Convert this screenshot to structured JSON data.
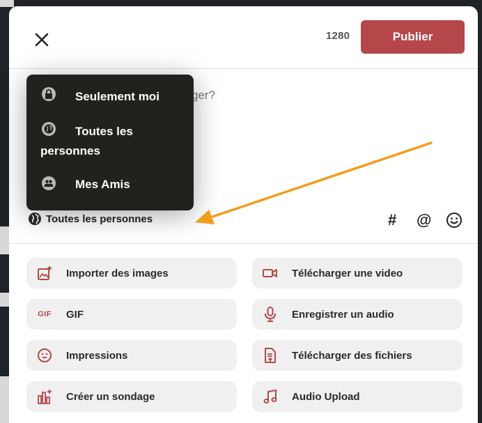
{
  "header": {
    "close_icon": "close-icon",
    "char_count": "1280",
    "publish_label": "Publier"
  },
  "composer": {
    "prompt_visible_fragment": "ger?"
  },
  "audience": {
    "icon": "globe-icon",
    "label": "Toutes les personnes"
  },
  "toolbar": {
    "hashtag": "#",
    "mention": "@",
    "emoji_icon": "smiley-icon"
  },
  "visibility_menu": {
    "items": [
      {
        "icon": "lock-icon",
        "label": "Seulement moi"
      },
      {
        "icon": "globe-icon",
        "label": "Toutes les personnes"
      },
      {
        "icon": "people-icon",
        "label": "Mes Amis"
      }
    ]
  },
  "actions": {
    "items": [
      {
        "icon": "image-upload-icon",
        "label": "Importer des images"
      },
      {
        "icon": "video-camera-icon",
        "label": "Télécharger une video"
      },
      {
        "icon": "gif-icon",
        "icon_text": "GIF",
        "label": "GIF"
      },
      {
        "icon": "microphone-icon",
        "label": "Enregistrer un audio"
      },
      {
        "icon": "smiley-icon",
        "label": "Impressions"
      },
      {
        "icon": "file-upload-icon",
        "label": "Télécharger des fichiers"
      },
      {
        "icon": "poll-icon",
        "label": "Créer un sondage"
      },
      {
        "icon": "music-note-icon",
        "label": "Audio Upload"
      }
    ]
  },
  "colors": {
    "accent": "#b5474b",
    "menu_bg": "#1f221d",
    "button_bg": "#f0f0f0",
    "annotation_arrow": "#f39c1b"
  }
}
